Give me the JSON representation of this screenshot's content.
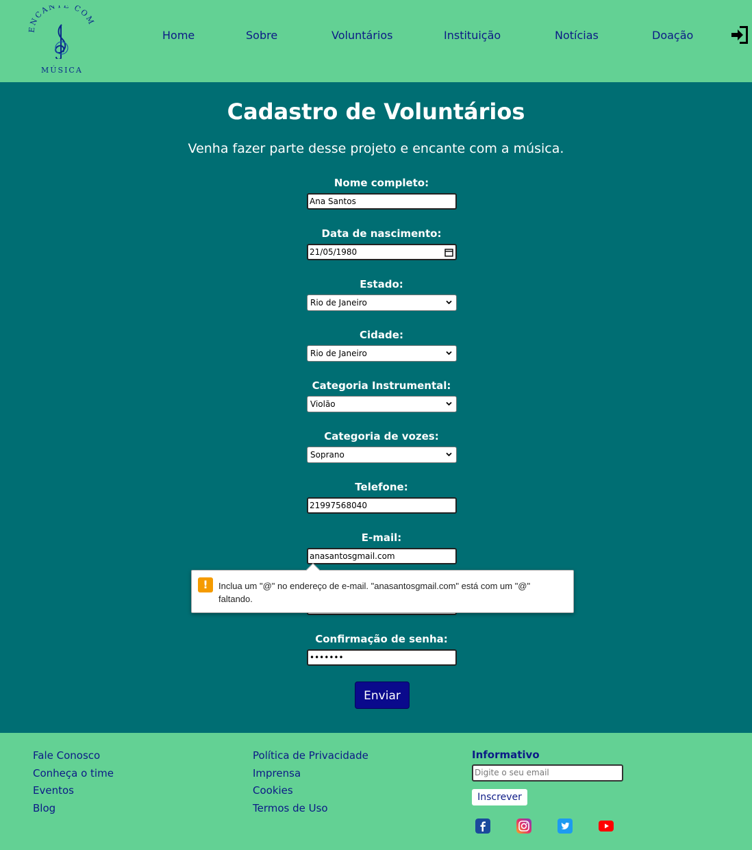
{
  "header": {
    "logo": {
      "top_text": "ENCANTE COM",
      "bottom_text": "MÚSICA",
      "clef_icon": "treble-clef-icon"
    },
    "nav": [
      "Home",
      "Sobre",
      "Voluntários",
      "Instituição",
      "Notícias",
      "Doação"
    ],
    "login_icon": "sign-in-icon"
  },
  "main": {
    "title": "Cadastro de Voluntários",
    "subtitle": "Venha fazer parte desse projeto e encante com a música.",
    "fields": {
      "nome": {
        "label": "Nome completo:",
        "value": "Ana Santos"
      },
      "nascimento": {
        "label": "Data de nascimento:",
        "value": "21/05/1980"
      },
      "estado": {
        "label": "Estado:",
        "value": "Rio de Janeiro"
      },
      "cidade": {
        "label": "Cidade:",
        "value": "Rio de Janeiro"
      },
      "instrumento": {
        "label": "Categoria Instrumental:",
        "value": "Violão"
      },
      "voz": {
        "label": "Categoria de vozes:",
        "value": "Soprano"
      },
      "telefone": {
        "label": "Telefone:",
        "value": "21997568040"
      },
      "email": {
        "label": "E-mail:",
        "value": "anasantosgmail.com"
      },
      "confirmacao": {
        "label": "Confirmação de senha:",
        "value": "•••••••"
      }
    },
    "validation_tooltip": "Inclua um \"@\" no endereço de e-mail. \"anasantosgmail.com\" está com um \"@\" faltando.",
    "submit_label": "Enviar"
  },
  "footer": {
    "col1": [
      "Fale Conosco",
      "Conheça o time",
      "Eventos",
      "Blog"
    ],
    "col2": [
      "Política de Privacidade",
      "Imprensa",
      "Cookies",
      "Termos de Uso"
    ],
    "newsletter": {
      "title": "Informativo",
      "placeholder": "Digite o seu email",
      "button": "Inscrever"
    },
    "social": [
      "facebook-icon",
      "instagram-icon",
      "twitter-icon",
      "youtube-icon"
    ]
  },
  "colors": {
    "header_bg": "#63d194",
    "main_bg": "#006e73",
    "nav_text": "#0c1a86",
    "submit_bg": "#0a0a8c",
    "warning": "#f59b00"
  }
}
